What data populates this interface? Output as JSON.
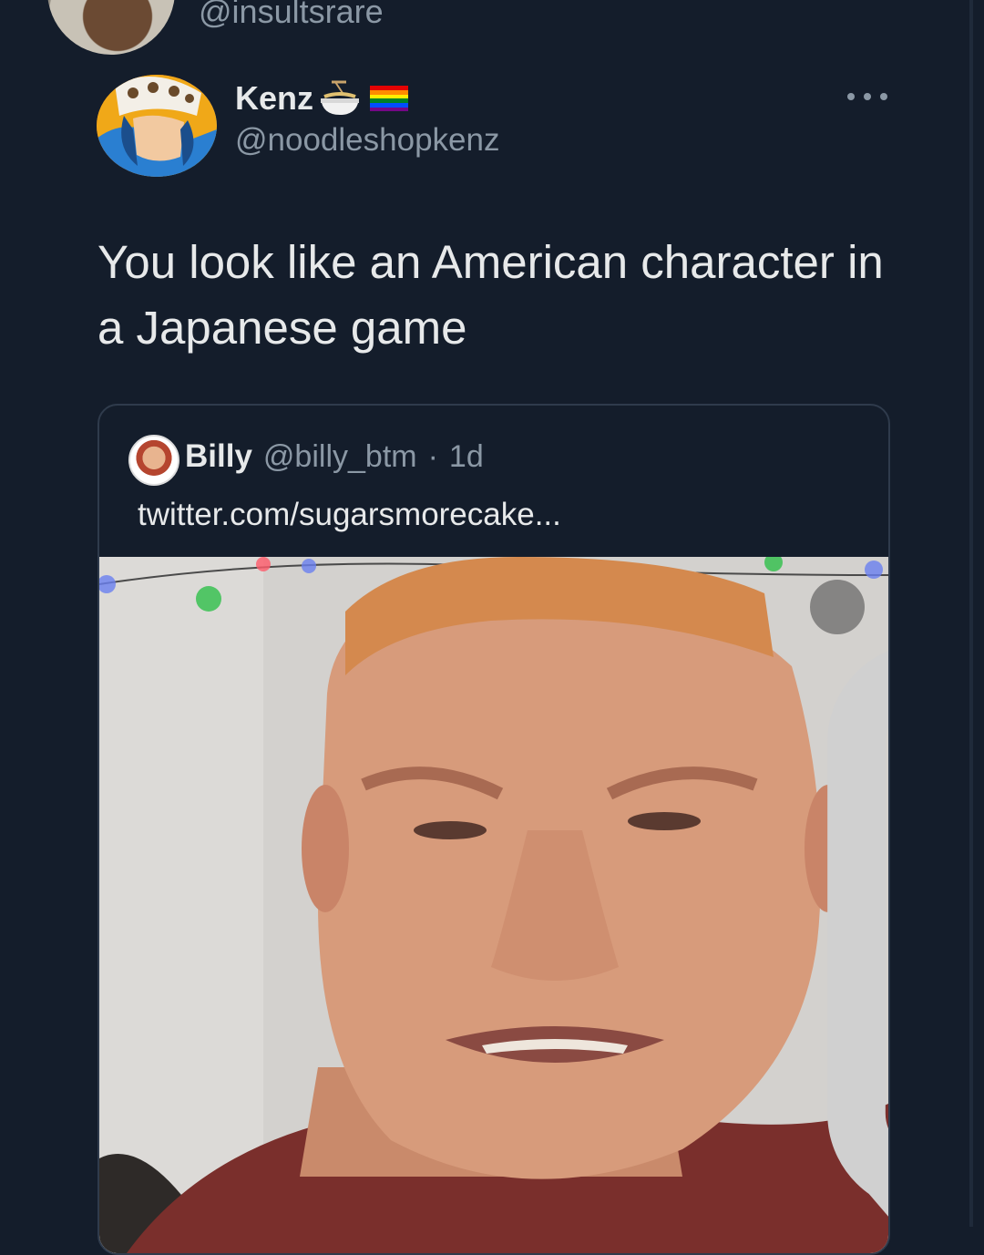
{
  "previous_tweet": {
    "handle": "@insultsrare"
  },
  "tweet": {
    "author_name": "Kenz",
    "author_emojis": [
      "ramen-bowl-icon",
      "rainbow-flag-icon"
    ],
    "author_handle": "@noodleshopkenz",
    "text": "You look like an American character in a Japanese game"
  },
  "quoted_tweet": {
    "author_name": "Billy",
    "author_handle": "@billy_btm",
    "separator": "·",
    "age": "1d",
    "link_text": "twitter.com/sugarsmorecake..."
  },
  "colors": {
    "background": "#141d2b",
    "primary_text": "#e7e9ea",
    "secondary_text": "#8b98a5",
    "card_border": "#2f3b4c"
  }
}
